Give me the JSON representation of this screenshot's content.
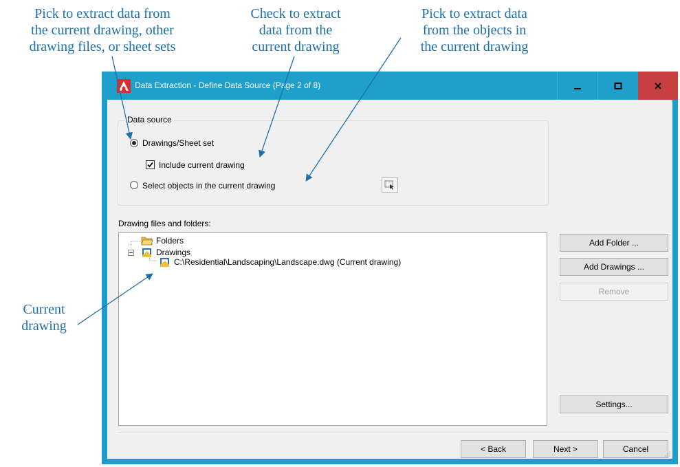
{
  "callouts": {
    "data_source": [
      "Pick to extract data from",
      "the current drawing, other",
      "drawing files, or sheet sets"
    ],
    "include_current": [
      "Check to extract",
      "data from the",
      "current drawing"
    ],
    "select_objects": [
      "Pick to extract data",
      "from the objects in",
      "the current drawing"
    ],
    "current_drawing": [
      "Current",
      "drawing"
    ]
  },
  "window": {
    "title": "Data Extraction - Define Data Source (Page 2 of 8)",
    "minimize_glyph": "—",
    "maximize_glyph": "☐",
    "close_glyph": "x"
  },
  "data_source": {
    "legend": "Data source",
    "drawings_option": "Drawings/Sheet set",
    "drawings_selected": true,
    "include_current_label": "Include current drawing",
    "include_current_checked": true,
    "select_objects_option": "Select objects in the current drawing",
    "select_objects_selected": false
  },
  "files": {
    "label": "Drawing files and folders:",
    "tree": {
      "folders": "Folders",
      "drawings": "Drawings",
      "current_file": "C:\\Residential\\Landscaping\\Landscape.dwg (Current drawing)"
    }
  },
  "side_buttons": {
    "add_folder": "Add Folder ...",
    "add_drawings": "Add Drawings ...",
    "remove": "Remove",
    "settings": "Settings..."
  },
  "nav": {
    "back": "< Back",
    "next": "Next >",
    "cancel": "Cancel"
  },
  "colors": {
    "callout_text": "#1e6fa8",
    "title_bar": "#1fa0cc",
    "close_button": "#c94040"
  },
  "icons": [
    "autocad-logo-icon",
    "minimize-icon",
    "maximize-icon",
    "close-icon",
    "select-objects-icon",
    "folder-icon",
    "drawings-icon",
    "drawing-file-icon",
    "tree-collapse-icon",
    "resize-grip-icon"
  ]
}
